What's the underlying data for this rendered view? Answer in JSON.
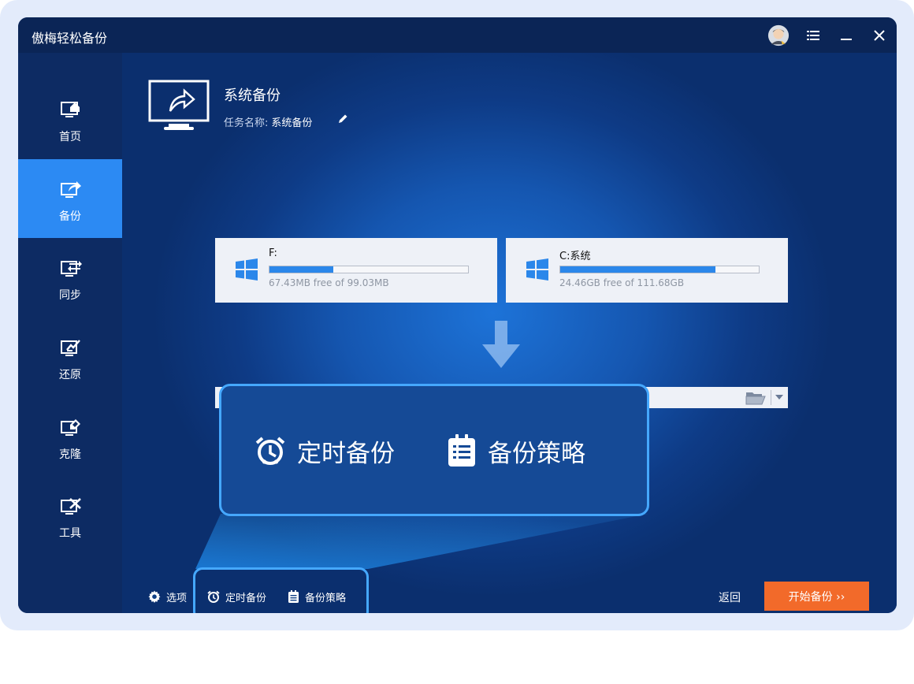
{
  "app": {
    "title": "傲梅轻松备份"
  },
  "titlebar": {
    "menu_icon": "menu-icon",
    "minimize_icon": "minimize-icon",
    "close_icon": "close-icon"
  },
  "sidebar": {
    "items": [
      {
        "label": "首页",
        "icon": "home-monitor-icon"
      },
      {
        "label": "备份",
        "icon": "backup-monitor-icon",
        "active": true
      },
      {
        "label": "同步",
        "icon": "sync-monitor-icon"
      },
      {
        "label": "还原",
        "icon": "restore-monitor-icon"
      },
      {
        "label": "克隆",
        "icon": "clone-monitor-icon"
      },
      {
        "label": "工具",
        "icon": "tools-monitor-icon"
      }
    ]
  },
  "main": {
    "title": "系统备份",
    "task_label": "任务名称:",
    "task_name": "系统备份",
    "sources": [
      {
        "name": "F:",
        "free_text": "67.43MB free of 99.03MB",
        "used_fraction": 0.32
      },
      {
        "name": "C:系统",
        "free_text": "24.46GB free of 111.68GB",
        "used_fraction": 0.78
      }
    ],
    "destination_value": ""
  },
  "zoom": {
    "schedule_label": "定时备份",
    "scheme_label": "备份策略"
  },
  "footer": {
    "options_label": "选项",
    "schedule_label": "定时备份",
    "scheme_label": "备份策略",
    "back_label": "返回",
    "start_label": "开始备份 ››"
  },
  "colors": {
    "accent": "#2c8af3",
    "start_button": "#f26a2a",
    "highlight_border": "#45a8ff",
    "sidebar_bg": "#0d2b63"
  }
}
